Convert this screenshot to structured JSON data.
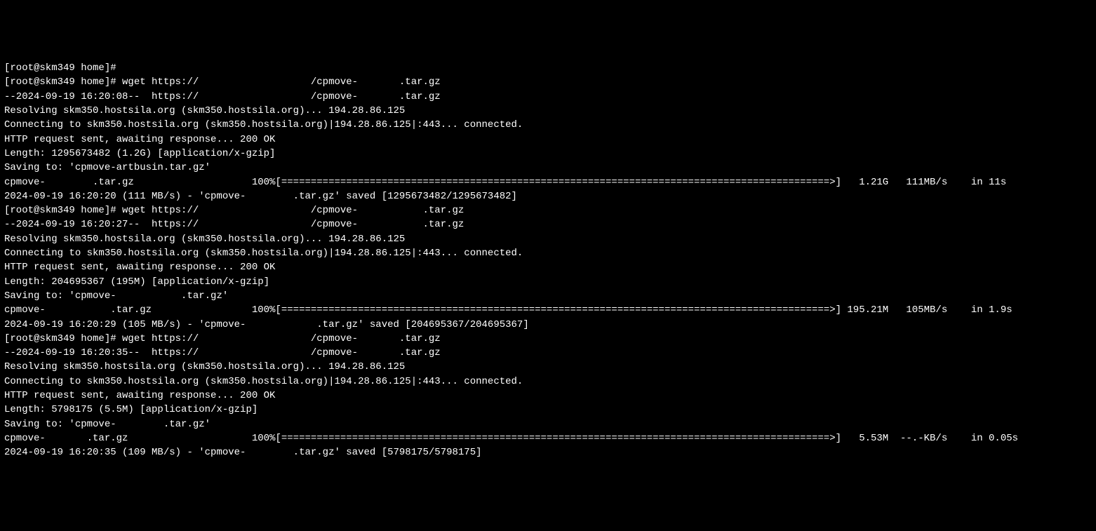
{
  "lines": [
    "[root@skm349 home]#",
    "[root@skm349 home]# wget https://                   /cpmove-       .tar.gz",
    "--2024-09-19 16:20:08--  https://                   /cpmove-       .tar.gz",
    "Resolving skm350.hostsila.org (skm350.hostsila.org)... 194.28.86.125",
    "Connecting to skm350.hostsila.org (skm350.hostsila.org)|194.28.86.125|:443... connected.",
    "HTTP request sent, awaiting response... 200 OK",
    "Length: 1295673482 (1.2G) [application/x-gzip]",
    "Saving to: 'cpmove-artbusin.tar.gz'",
    "",
    "cpmove-        .tar.gz                    100%[=============================================================================================>]   1.21G   111MB/s    in 11s",
    "",
    "2024-09-19 16:20:20 (111 MB/s) - 'cpmove-        .tar.gz' saved [1295673482/1295673482]",
    "",
    "[root@skm349 home]# wget https://                   /cpmove-           .tar.gz",
    "--2024-09-19 16:20:27--  https://                   /cpmove-           .tar.gz",
    "Resolving skm350.hostsila.org (skm350.hostsila.org)... 194.28.86.125",
    "Connecting to skm350.hostsila.org (skm350.hostsila.org)|194.28.86.125|:443... connected.",
    "HTTP request sent, awaiting response... 200 OK",
    "Length: 204695367 (195M) [application/x-gzip]",
    "Saving to: 'cpmove-           .tar.gz'",
    "",
    "cpmove-           .tar.gz                 100%[=============================================================================================>] 195.21M   105MB/s    in 1.9s",
    "",
    "2024-09-19 16:20:29 (105 MB/s) - 'cpmove-            .tar.gz' saved [204695367/204695367]",
    "",
    "[root@skm349 home]# wget https://                   /cpmove-       .tar.gz",
    "--2024-09-19 16:20:35--  https://                   /cpmove-       .tar.gz",
    "Resolving skm350.hostsila.org (skm350.hostsila.org)... 194.28.86.125",
    "Connecting to skm350.hostsila.org (skm350.hostsila.org)|194.28.86.125|:443... connected.",
    "HTTP request sent, awaiting response... 200 OK",
    "Length: 5798175 (5.5M) [application/x-gzip]",
    "Saving to: 'cpmove-        .tar.gz'",
    "",
    "cpmove-       .tar.gz                     100%[=============================================================================================>]   5.53M  --.-KB/s    in 0.05s",
    "",
    "2024-09-19 16:20:35 (109 MB/s) - 'cpmove-        .tar.gz' saved [5798175/5798175]"
  ]
}
